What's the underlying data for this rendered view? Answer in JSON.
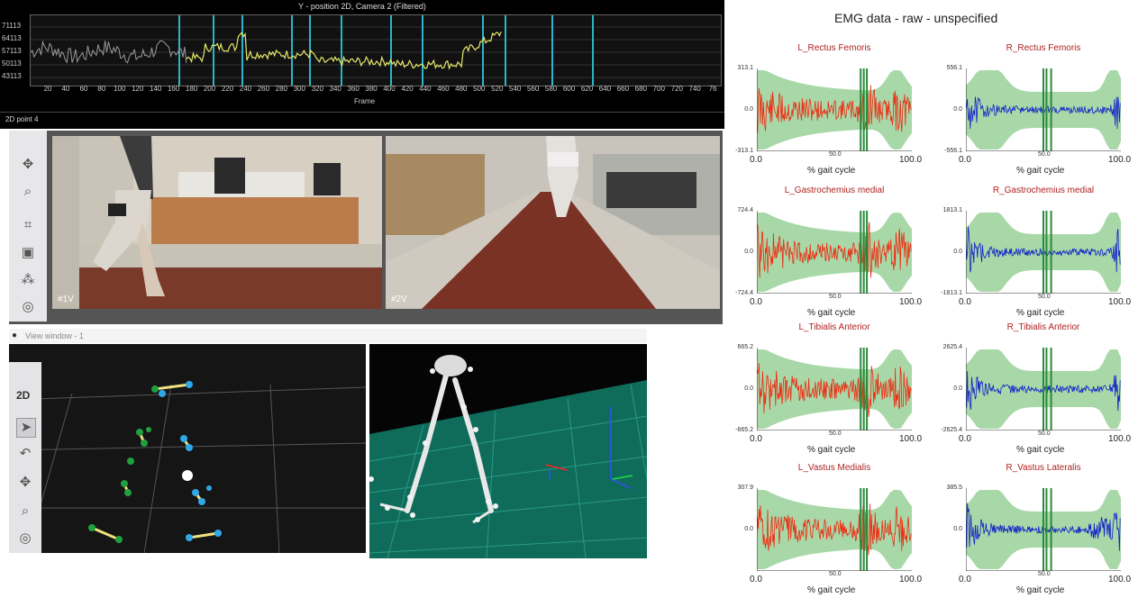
{
  "graph": {
    "title": "Y - position 2D, Camera 2 (Filtered)",
    "y_ticks": [
      "71113",
      "64113",
      "57113",
      "50113",
      "43113"
    ],
    "x_ticks": [
      "20",
      "40",
      "60",
      "80",
      "100",
      "120",
      "140",
      "160",
      "180",
      "200",
      "220",
      "240",
      "260",
      "280",
      "300",
      "320",
      "340",
      "360",
      "380",
      "400",
      "420",
      "440",
      "460",
      "480",
      "500",
      "520",
      "540",
      "560",
      "580",
      "600",
      "620",
      "640",
      "660",
      "680",
      "700",
      "720",
      "740",
      "76"
    ],
    "x_label": "Frame",
    "point_label": "2D point 4",
    "colors": {
      "trace_gray": "#9a9a9a",
      "trace_yellow": "#e6e86a",
      "marker_cyan": "#2ab6c8"
    }
  },
  "video": {
    "cam1_label": "#1V",
    "cam2_label": "#2V"
  },
  "view_window": {
    "title": "View window - 1",
    "mode_2d": "2D"
  },
  "emg": {
    "title": "EMG data - raw - unspecified",
    "x_label": "% gait cycle",
    "x_min": "0.0",
    "x_mid": "50.0",
    "x_max": "100.0",
    "zero": "0.0",
    "colors": {
      "left": "#ee2a10",
      "right": "#1020c8",
      "band": "#a8d8a8",
      "events": "#2a8a3a"
    },
    "charts": [
      {
        "name": "L_Rectus Femoris",
        "ymax": "313.1",
        "ymin": "-313.1"
      },
      {
        "name": "R_Rectus Femoris",
        "ymax": "556.1",
        "ymin": "-556.1"
      },
      {
        "name": "L_Gastrochemius medial",
        "ymax": "724.4",
        "ymin": "-724.4"
      },
      {
        "name": "R_Gastrochemius medial",
        "ymax": "1813.1",
        "ymin": "-1813.1"
      },
      {
        "name": "L_Tibialis Anterior",
        "ymax": "665.2",
        "ymin": "-665.2"
      },
      {
        "name": "R_Tibialis Anterior",
        "ymax": "2625.4",
        "ymin": "-2625.4"
      },
      {
        "name": "L_Vastus Medialis",
        "ymax": "307.9",
        "ymin": ""
      },
      {
        "name": "R_Vastus Lateralis",
        "ymax": "385.5",
        "ymin": ""
      }
    ]
  }
}
